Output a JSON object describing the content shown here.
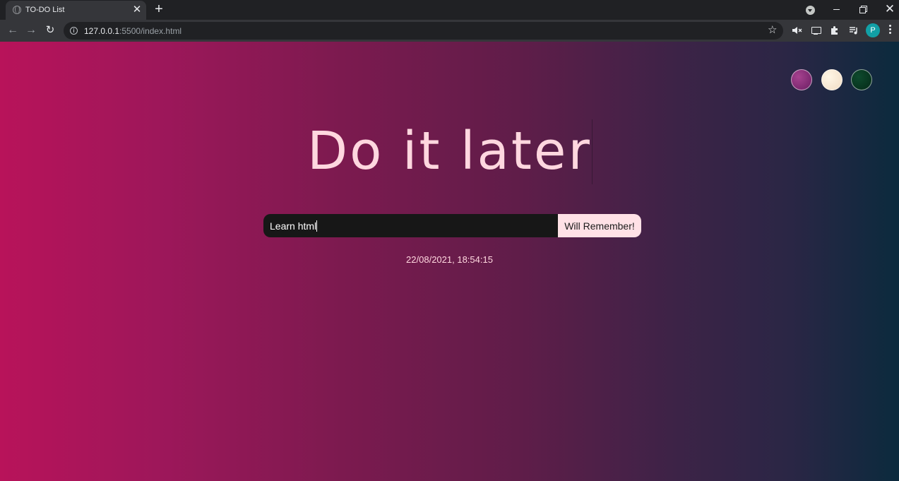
{
  "browser": {
    "tab": {
      "title": "TO-DO List",
      "close_glyph": "✕"
    },
    "new_tab_glyph": "+",
    "url": {
      "host": "127.0.0.1",
      "path": ":5500/index.html"
    },
    "profile_initial": "P",
    "icons": [
      "globe-icon",
      "close-icon",
      "plus-icon",
      "tab-search-icon",
      "back-icon",
      "forward-icon",
      "reload-icon",
      "info-icon",
      "star-icon",
      "mute-icon",
      "cast-icon",
      "puzzle-icon",
      "media-queue-icon",
      "kebab-menu-icon"
    ]
  },
  "page": {
    "title": "Do it later",
    "todo_input_value": "Learn html",
    "submit_label": "Will Remember!",
    "datetime": "22/08/2021, 18:54:15",
    "theme_colors": [
      "#8a2a76",
      "#f8ead6",
      "#0a3a22"
    ]
  },
  "colors": {
    "title_text": "#ffd7df",
    "button_bg": "#ffe1e6",
    "input_bg": "#171717",
    "gradient_left": "#b8135a",
    "gradient_right": "#0b2a3d"
  }
}
